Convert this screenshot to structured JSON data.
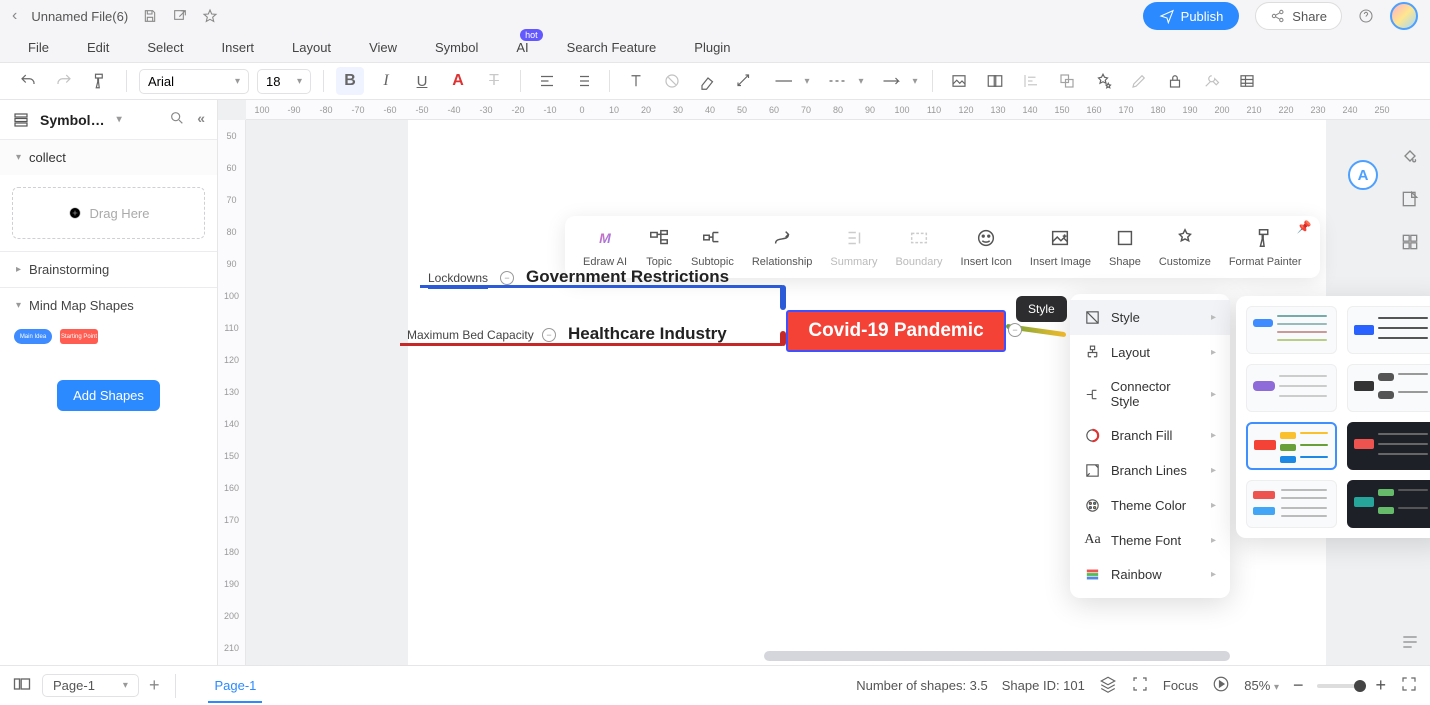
{
  "title": {
    "filename": "Unnamed File(6)"
  },
  "header": {
    "publish": "Publish",
    "share": "Share"
  },
  "menu": {
    "file": "File",
    "edit": "Edit",
    "select": "Select",
    "insert": "Insert",
    "layout": "Layout",
    "view": "View",
    "symbol": "Symbol",
    "ai": "AI",
    "ai_badge": "hot",
    "search": "Search Feature",
    "plugin": "Plugin"
  },
  "toolbar": {
    "font": "Arial",
    "size": "18"
  },
  "sidebar": {
    "title": "Symbol…",
    "collect": "collect",
    "drag": "Drag Here",
    "brainstorming": "Brainstorming",
    "mindmap": "Mind Map Shapes",
    "chip1": "Main Idea",
    "chip2": "Starting Point",
    "addshapes": "Add Shapes"
  },
  "ruler_h": [
    "100",
    "-90",
    "-80",
    "-70",
    "-60",
    "-50",
    "-40",
    "-30",
    "-20",
    "-10",
    "0",
    "10",
    "20",
    "30",
    "40",
    "50",
    "60",
    "70",
    "80",
    "90",
    "100",
    "110",
    "120",
    "130",
    "140",
    "150",
    "160",
    "170",
    "180",
    "190",
    "200",
    "210",
    "220",
    "230",
    "240",
    "250"
  ],
  "ruler_v": [
    "50",
    "60",
    "70",
    "80",
    "90",
    "100",
    "110",
    "120",
    "130",
    "140",
    "150",
    "160",
    "170",
    "180",
    "190",
    "200",
    "210"
  ],
  "floatbar": {
    "edraw_ai": "Edraw AI",
    "topic": "Topic",
    "subtopic": "Subtopic",
    "relationship": "Relationship",
    "summary": "Summary",
    "boundary": "Boundary",
    "insert_icon": "Insert Icon",
    "insert_image": "Insert Image",
    "shape": "Shape",
    "customize": "Customize",
    "format_painter": "Format Painter"
  },
  "mindmap": {
    "central": "Covid-19 Pandemic",
    "branch1": "Government Restrictions",
    "branch1_sub": "Lockdowns",
    "branch2": "Healthcare Industry",
    "branch2_sub": "Maximum Bed Capacity"
  },
  "tooltip": {
    "style": "Style"
  },
  "dropdown": {
    "style": "Style",
    "layout": "Layout",
    "connector": "Connector Style",
    "branch_fill": "Branch Fill",
    "branch_lines": "Branch Lines",
    "theme_color": "Theme Color",
    "theme_font": "Theme Font",
    "rainbow": "Rainbow"
  },
  "bottombar": {
    "page_sel": "Page-1",
    "page_tab": "Page-1",
    "shapes": "Number of shapes: 3.5",
    "shape_id": "Shape ID: 101",
    "focus": "Focus",
    "zoom": "85%"
  }
}
